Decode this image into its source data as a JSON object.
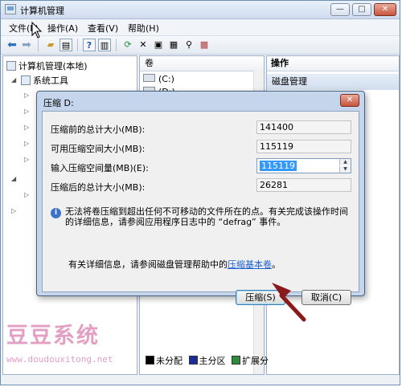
{
  "window": {
    "title": "计算机管理",
    "controls": {
      "minimize": "—",
      "maximize": "□",
      "close": "✕"
    }
  },
  "menubar": {
    "items": [
      "文件(F)",
      "操作(A)",
      "查看(V)",
      "帮助(H)"
    ]
  },
  "toolbar": {
    "icons": [
      "back-arrow-icon",
      "forward-arrow-icon",
      "up-folder-icon",
      "show-hide-tree-icon",
      "help-icon",
      "console-icon",
      "refresh-icon",
      "delete-icon",
      "properties-icon",
      "search-icon",
      "export-icon"
    ]
  },
  "tree": {
    "root": "计算机管理(本地)",
    "system_tools": "系统工具"
  },
  "volumes": {
    "header": "卷",
    "items": [
      "(C:)",
      "(D:)"
    ]
  },
  "actions": {
    "header": "操作",
    "section": "磁盘管理"
  },
  "legend": {
    "items": [
      {
        "label": "未分配",
        "color": "#000000"
      },
      {
        "label": "主分区",
        "color": "#1c2d9a"
      },
      {
        "label": "扩展分",
        "color": "#2e8b3a"
      }
    ]
  },
  "dialog": {
    "title": "压缩 D:",
    "close": "✕",
    "rows": [
      {
        "label": "压缩前的总计大小(MB):",
        "value": "141400"
      },
      {
        "label": "可用压缩空间大小(MB):",
        "value": "115119"
      },
      {
        "label": "输入压缩空间量(MB)(E):",
        "value": "115119"
      },
      {
        "label": "压缩后的总计大小(MB):",
        "value": "26281"
      }
    ],
    "info": "无法将卷压缩到超出任何不可移动的文件所在的点。有关完成该操作时间的详细信息，请参阅应用程序日志中的 “defrag” 事件。",
    "help_prefix": "有关详细信息，请参阅磁盘管理帮助中的",
    "help_link": "压缩基本卷",
    "help_suffix": "。",
    "ok_button": "压缩(S)",
    "cancel_button": "取消(C)"
  },
  "watermark": {
    "title": "豆豆系统",
    "url": "www.doudouxitong.net",
    "color": "#e39fc3"
  }
}
